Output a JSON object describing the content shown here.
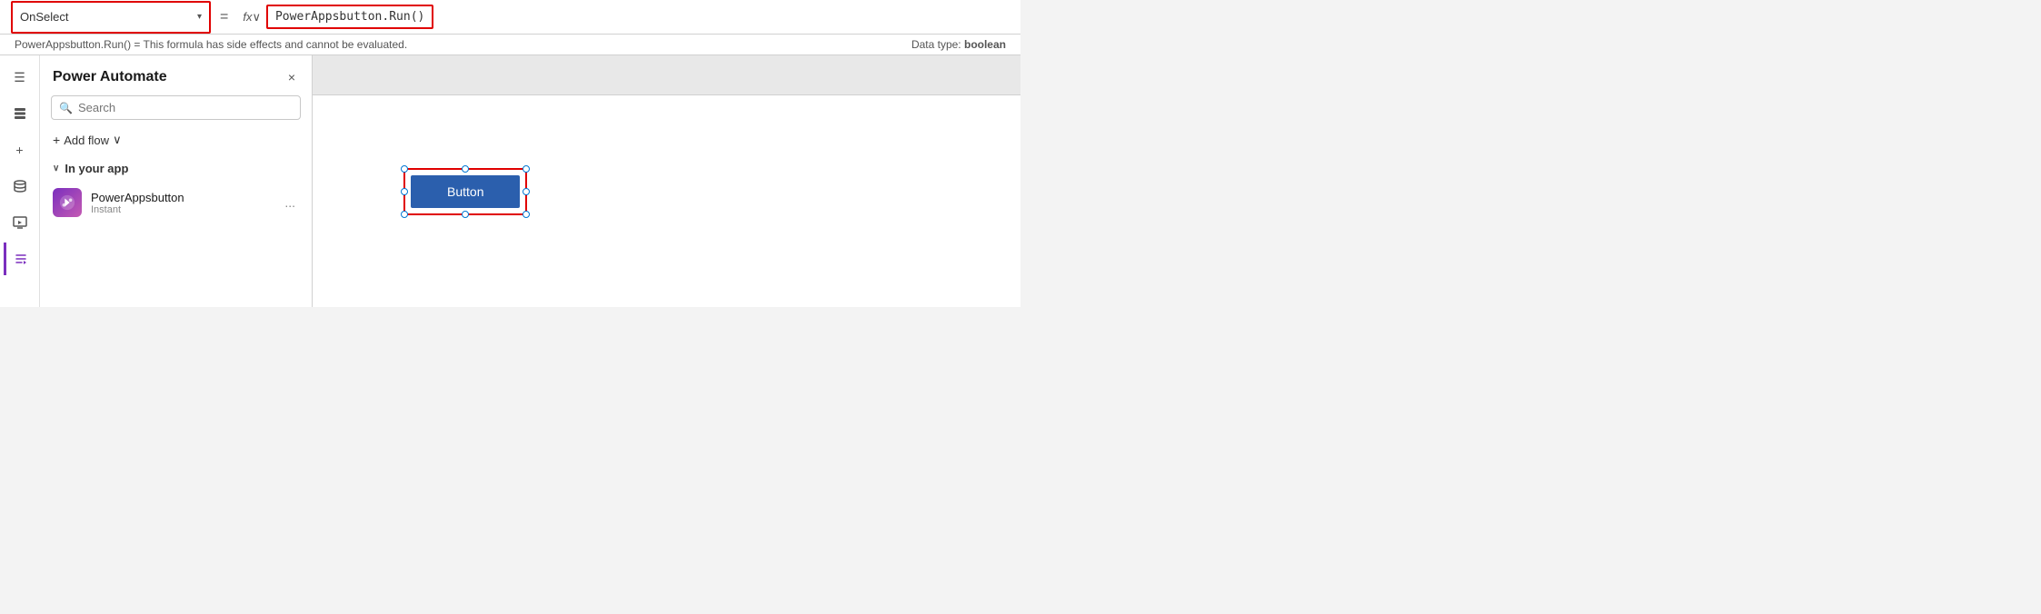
{
  "formula_bar": {
    "property": "OnSelect",
    "equals": "=",
    "fx_label": "fx",
    "formula": "PowerAppsbutton.Run()",
    "hint": "PowerAppsbutton.Run()  =  This formula has side effects and cannot be evaluated.",
    "data_type_label": "Data type:",
    "data_type_value": "boolean"
  },
  "sidebar": {
    "icons": [
      {
        "name": "hamburger-icon",
        "symbol": "☰"
      },
      {
        "name": "layers-icon",
        "symbol": "⊞"
      },
      {
        "name": "add-icon",
        "symbol": "+"
      },
      {
        "name": "database-icon",
        "symbol": "⬡"
      },
      {
        "name": "media-icon",
        "symbol": "▶"
      },
      {
        "name": "active-icon",
        "symbol": "»"
      }
    ]
  },
  "power_automate_panel": {
    "title": "Power Automate",
    "close_label": "×",
    "search_placeholder": "Search",
    "add_flow_label": "Add flow",
    "chevron": "∨",
    "in_your_app_label": "In your app",
    "flows": [
      {
        "name": "PowerAppsbutton",
        "type": "Instant",
        "more_label": "..."
      }
    ]
  },
  "canvas": {
    "button_label": "Button"
  }
}
